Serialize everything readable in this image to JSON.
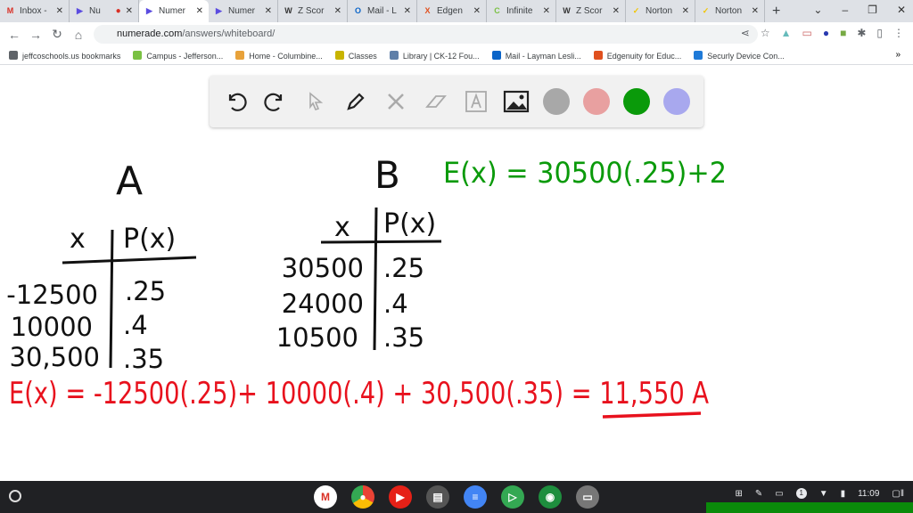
{
  "tabs": [
    {
      "title": "Inbox -",
      "icon": "gmail-icon",
      "color": "#d93025",
      "letter": "M"
    },
    {
      "title": "Nu",
      "icon": "numerade-icon",
      "color": "#5b4ce0",
      "letter": "▶",
      "recording": true
    },
    {
      "title": "Numer",
      "icon": "numerade-icon",
      "color": "#5b4ce0",
      "letter": "▶",
      "active": true
    },
    {
      "title": "Numer",
      "icon": "numerade-icon",
      "color": "#5b4ce0",
      "letter": "▶"
    },
    {
      "title": "Z Scor",
      "icon": "wiki-icon",
      "color": "#333333",
      "letter": "W"
    },
    {
      "title": "Mail - L",
      "icon": "outlook-icon",
      "color": "#0a64c8",
      "letter": "O"
    },
    {
      "title": "Edgen",
      "icon": "edgenuity-icon",
      "color": "#e0501e",
      "letter": "X"
    },
    {
      "title": "Infinite",
      "icon": "infinite-campus-icon",
      "color": "#7ac143",
      "letter": "C"
    },
    {
      "title": "Z Scor",
      "icon": "wiki-icon",
      "color": "#333333",
      "letter": "W"
    },
    {
      "title": "Norton",
      "icon": "norton-icon",
      "color": "#f2c500",
      "letter": "✓"
    },
    {
      "title": "Norton",
      "icon": "norton-icon",
      "color": "#f2c500",
      "letter": "✓"
    }
  ],
  "address": {
    "domain": "numerade.com",
    "path": "/answers/whiteboard/"
  },
  "bookmarks": [
    {
      "label": "jeffcoschools.us bookmarks",
      "color": "#5f6368"
    },
    {
      "label": "Campus - Jefferson...",
      "color": "#7ac143"
    },
    {
      "label": "Home - Columbine...",
      "color": "#e8a23a"
    },
    {
      "label": "Classes",
      "color": "#c8b400"
    },
    {
      "label": "Library | CK-12 Fou...",
      "color": "#5f7fa8"
    },
    {
      "label": "Mail - Layman Lesli...",
      "color": "#0a64c8"
    },
    {
      "label": "Edgenuity for Educ...",
      "color": "#e0501e"
    },
    {
      "label": "Securly Device Con...",
      "color": "#1e7ad8"
    }
  ],
  "toolbar": {
    "colors": [
      "#a8a8a8",
      "#e8a0a0",
      "#0a9a0a",
      "#a8a8ee"
    ]
  },
  "board": {
    "labelA": "A",
    "labelB": "B",
    "green_eq": "E(x) = 30500(.25)+2",
    "tableA": {
      "x": "x",
      "p": "P(x)",
      "rows": [
        [
          "-12500",
          ".25"
        ],
        [
          "10000",
          ".4"
        ],
        [
          "30,500",
          ".35"
        ]
      ]
    },
    "tableB": {
      "x": "x",
      "p": "P(x)",
      "rows": [
        [
          "30500",
          ".25"
        ],
        [
          "24000",
          ".4"
        ],
        [
          "10500",
          ".35"
        ]
      ]
    },
    "red_eq": "E(x) = -12500(.25)+ 10000(.4) + 30,500(.35) = 11,550 A"
  },
  "tray": {
    "time": "11:09",
    "notifications": "1"
  }
}
